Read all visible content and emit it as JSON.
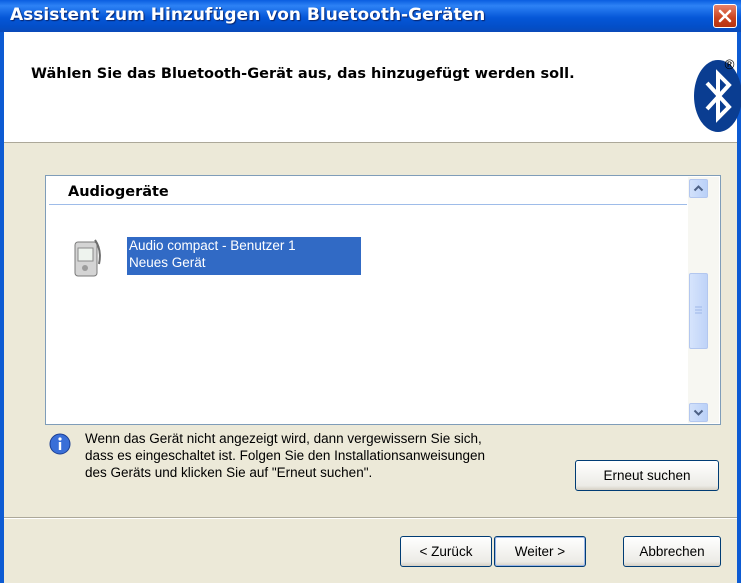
{
  "window": {
    "title": "Assistent zum Hinzufügen von Bluetooth-Geräten"
  },
  "header": {
    "title": "Wählen Sie das Bluetooth-Gerät aus, das hinzugefügt werden soll.",
    "registered_mark": "®"
  },
  "device_list": {
    "group": "Audiogeräte",
    "items": [
      {
        "name": "Audio compact - Benutzer 1",
        "status": "Neues Gerät",
        "selected": true,
        "icon": "audio-device-icon"
      }
    ]
  },
  "info": {
    "lines": [
      "Wenn das Gerät nicht angezeigt wird, dann vergewissern Sie sich,",
      "dass es eingeschaltet ist. Folgen Sie den Installationsanweisungen",
      "des Geräts und klicken Sie auf \"Erneut suchen\"."
    ]
  },
  "buttons": {
    "search_again": "Erneut suchen",
    "back": "< Zurück",
    "next": "Weiter >",
    "cancel": "Abbrechen"
  },
  "colors": {
    "titlebar": "#0a5ee0",
    "selection": "#316ac5",
    "dialog_bg": "#ece9d8",
    "bluetooth": "#0a3d91"
  }
}
